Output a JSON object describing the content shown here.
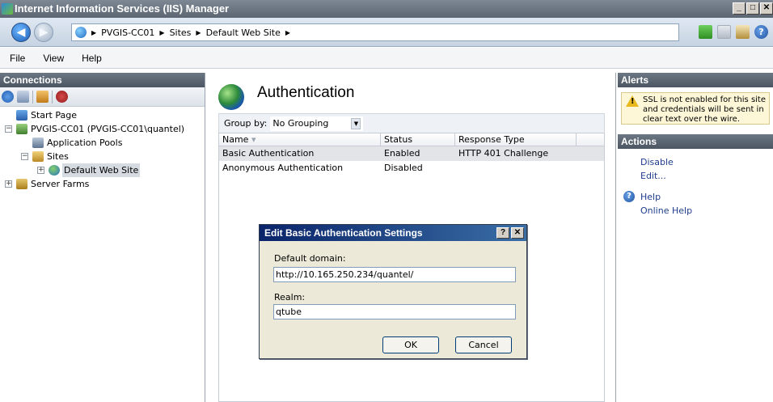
{
  "window": {
    "title": "Internet Information Services (IIS) Manager",
    "min": "_",
    "max": "□",
    "close": "✕"
  },
  "address": {
    "crumbs": [
      "PVGIS-CC01",
      "Sites",
      "Default Web Site"
    ]
  },
  "menu": {
    "items": [
      "File",
      "View",
      "Help"
    ]
  },
  "connections": {
    "header": "Connections",
    "tree": {
      "start_page": "Start Page",
      "server": "PVGIS-CC01 (PVGIS-CC01\\quantel)",
      "app_pools": "Application Pools",
      "sites": "Sites",
      "default_site": "Default Web Site",
      "server_farms": "Server Farms"
    }
  },
  "main": {
    "title": "Authentication",
    "group_by_label": "Group by:",
    "group_by_value": "No Grouping",
    "columns": [
      "Name",
      "Status",
      "Response Type"
    ],
    "rows": [
      {
        "name": "Basic Authentication",
        "status": "Enabled",
        "response": "HTTP 401 Challenge"
      },
      {
        "name": "Anonymous Authentication",
        "status": "Disabled",
        "response": ""
      }
    ]
  },
  "alerts": {
    "header": "Alerts",
    "message": "SSL is not enabled for this site and credentials will be sent in clear text over the wire."
  },
  "actions": {
    "header": "Actions",
    "disable": "Disable",
    "edit": "Edit...",
    "help": "Help",
    "online_help": "Online Help"
  },
  "dialog": {
    "title": "Edit Basic Authentication Settings",
    "help_btn": "?",
    "close_btn": "✕",
    "domain_label": "Default domain:",
    "domain_value": "http://10.165.250.234/quantel/",
    "realm_label": "Realm:",
    "realm_value": "qtube",
    "ok": "OK",
    "cancel": "Cancel"
  }
}
